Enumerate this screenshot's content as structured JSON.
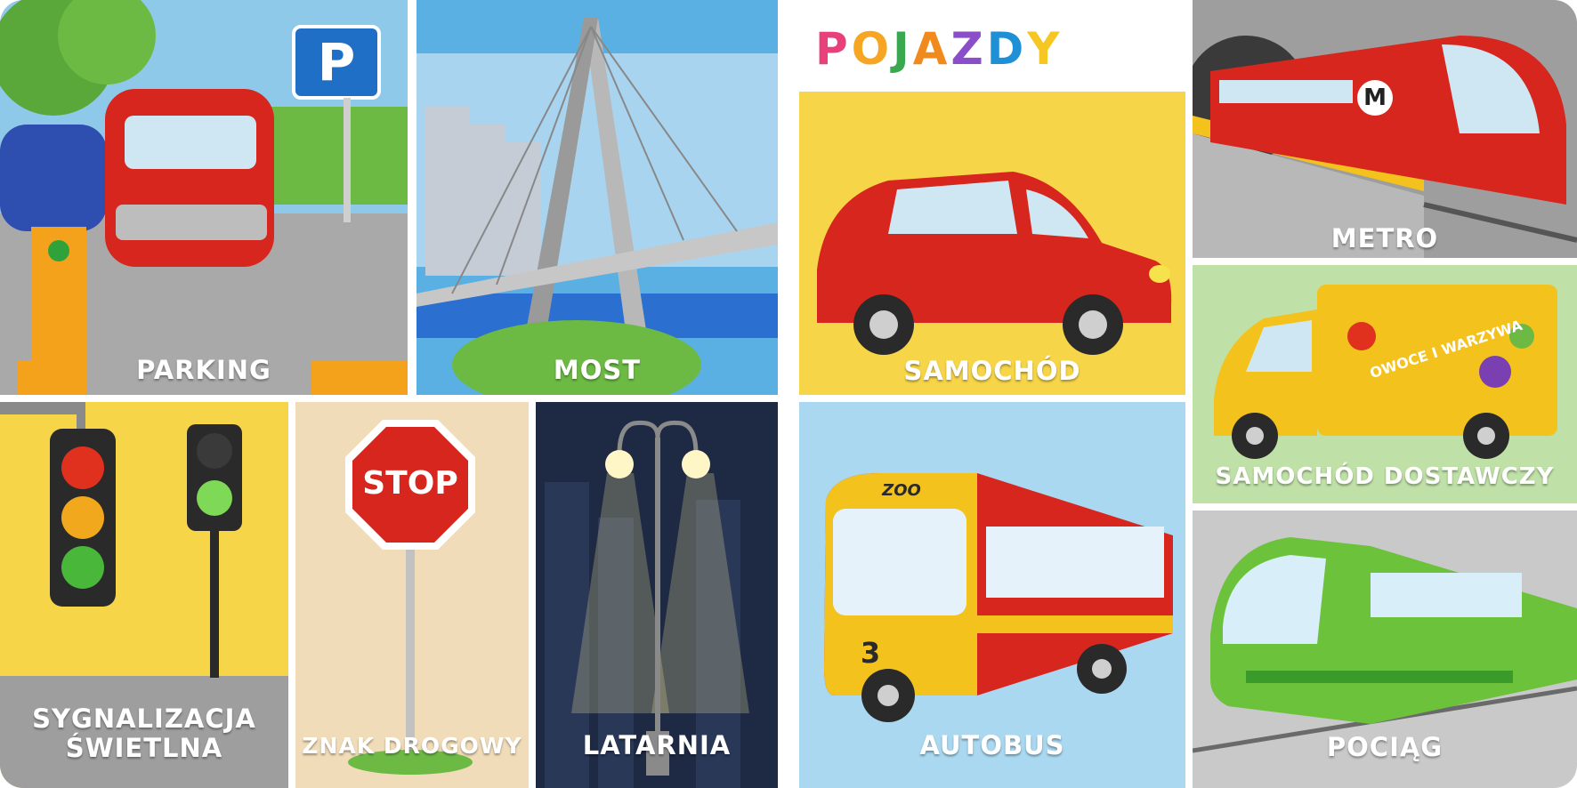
{
  "title": {
    "text": "POJAZDY",
    "letter_colors": [
      "#e8407a",
      "#f6a623",
      "#3aa84f",
      "#f08a1c",
      "#8a4fc8",
      "#1f8fd6",
      "#f6c623"
    ]
  },
  "cards": {
    "parking": {
      "label": "PARKING",
      "sign": "P"
    },
    "most": {
      "label": "MOST"
    },
    "samochod": {
      "label": "SAMOCHÓD"
    },
    "metro": {
      "label": "METRO",
      "logo": "M"
    },
    "sygnalizacja": {
      "label": "SYGNALIZACJA\nŚWIETLNA"
    },
    "znak": {
      "label": "ZNAK DROGOWY",
      "sign": "STOP"
    },
    "latarnia": {
      "label": "LATARNIA"
    },
    "autobus": {
      "label": "AUTOBUS",
      "route_number": "3",
      "destination": "ZOO"
    },
    "dostawczy": {
      "label": "SAMOCHÓD DOSTAWCZY",
      "truck_text": "OWOCE I WARZYWA"
    },
    "pociag": {
      "label": "POCIĄG"
    }
  },
  "colors": {
    "card_yellow": "#f7d548",
    "card_sky": "#a9d8f0",
    "card_green": "#bfe0a6",
    "card_grey": "#c9c9c9",
    "card_beige": "#f0dcb8",
    "card_night": "#1e2a44",
    "vehicle_red": "#d7261e",
    "bus_yellow": "#f4c21c",
    "train_green": "#6cc23a"
  }
}
